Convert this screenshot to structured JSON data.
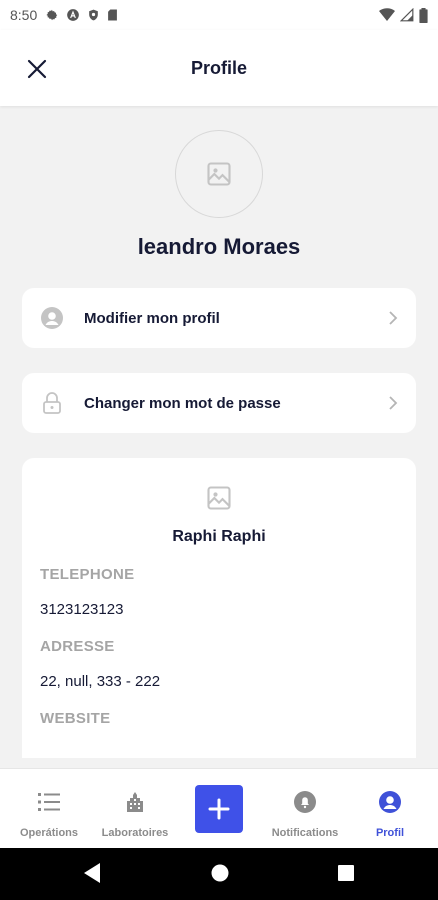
{
  "status_bar": {
    "time": "8:50",
    "left_icons": [
      "gear-icon",
      "a-icon",
      "shield-icon",
      "sd-card-icon"
    ],
    "right_icons": [
      "wifi-icon",
      "signal-icon",
      "battery-icon"
    ]
  },
  "header": {
    "title": "Profile",
    "close_icon": "close-icon"
  },
  "profile": {
    "avatar_icon": "image-placeholder-icon",
    "name": "leandro Moraes"
  },
  "menu": [
    {
      "label": "Modifier mon profil",
      "icon": "user-circle-icon"
    },
    {
      "label": "Changer mon mot de passe",
      "icon": "lock-icon"
    }
  ],
  "company": {
    "icon": "image-placeholder-icon",
    "name": "Raphi Raphi",
    "fields": [
      {
        "label": "TELEPHONE",
        "value": "3123123123"
      },
      {
        "label": "ADRESSE",
        "value": "22, null, 333 - 222"
      },
      {
        "label": "WEBSITE",
        "value": ""
      }
    ]
  },
  "bottom_nav": {
    "items": [
      {
        "label": "Operátions",
        "icon": "list-icon",
        "active": false
      },
      {
        "label": "Laboratoires",
        "icon": "building-icon",
        "active": false
      },
      {
        "label": "Notifications",
        "icon": "bell-icon",
        "active": false
      },
      {
        "label": "Profil",
        "icon": "user-circle-icon",
        "active": true
      }
    ],
    "fab_icon": "plus-icon"
  },
  "colors": {
    "accent": "#3f51e8",
    "text_dark": "#161a35",
    "label_gray": "#a5a5a5",
    "background": "#f2f2f2"
  }
}
